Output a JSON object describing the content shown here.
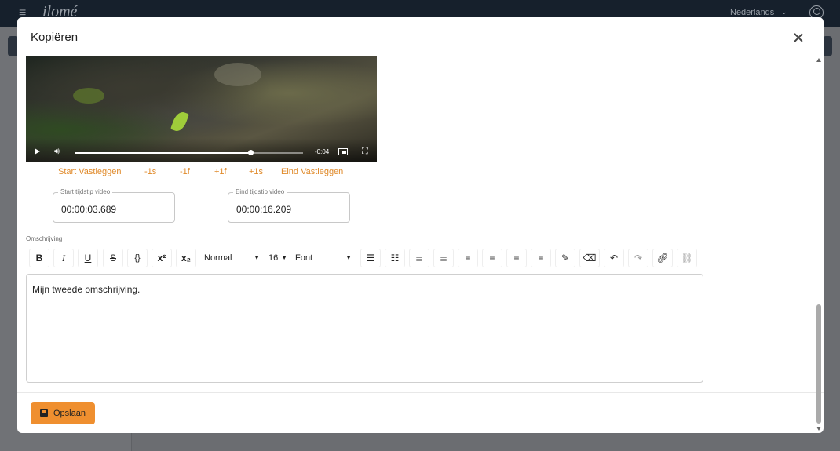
{
  "app": {
    "logo_text": "ilomé",
    "language": "Nederlands",
    "icons": [
      "hamburger-icon",
      "chevron-down-icon",
      "user-icon"
    ]
  },
  "modal": {
    "title": "Kopiëren",
    "close_icon": "close-icon"
  },
  "video": {
    "time_display": "-0:04",
    "progress": 0.77,
    "icons": [
      "play-icon",
      "volume-icon",
      "picture-in-picture-icon",
      "fullscreen-icon"
    ]
  },
  "capture": {
    "start_label": "Start Vastleggen",
    "minus_1s": "-1s",
    "minus_1f": "-1f",
    "plus_1f": "+1f",
    "plus_1s": "+1s",
    "end_label": "Eind Vastleggen"
  },
  "fields": {
    "start": {
      "label": "Start tijdstip video",
      "value": "00:00:03.689"
    },
    "end": {
      "label": "Eind tijdstip video",
      "value": "00:00:16.209"
    }
  },
  "description": {
    "label": "Omschrijving",
    "text": "Mijn tweede omschrijving."
  },
  "toolbar": {
    "bold": "B",
    "italic": "I",
    "underline": "U",
    "strike": "S",
    "code": "{}",
    "superscript": "x²",
    "subscript": "x₂",
    "heading": "Normal",
    "size": "16",
    "font": "Font",
    "icons": [
      "bullet-list-icon",
      "numbered-list-icon",
      "outdent-icon",
      "indent-icon",
      "align-left-icon",
      "align-center-icon",
      "align-right-icon",
      "align-justify-icon",
      "text-color-icon",
      "clear-format-icon",
      "undo-icon",
      "redo-icon",
      "link-icon",
      "unlink-icon"
    ]
  },
  "footer": {
    "save_label": "Opslaan",
    "save_icon": "save-icon"
  },
  "colors": {
    "accent": "#ef8f2f",
    "link_orange": "#e08a2a",
    "topbar": "#16202c"
  }
}
